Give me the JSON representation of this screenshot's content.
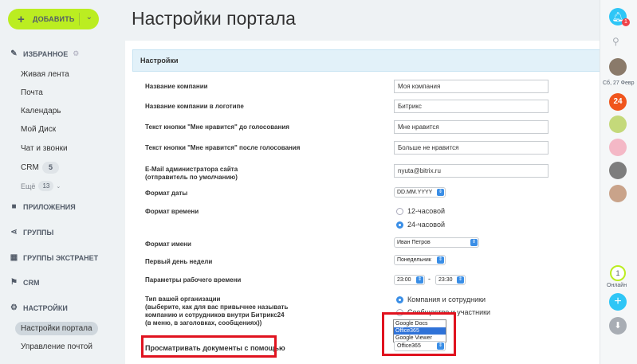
{
  "sidebar": {
    "add_label": "ДОБАВИТЬ",
    "favorites": "ИЗБРАННОЕ",
    "items": [
      "Живая лента",
      "Почта",
      "Календарь",
      "Мой Диск",
      "Чат и звонки",
      "CRM"
    ],
    "crm_count": "5",
    "more_label": "Ещё",
    "more_count": "13",
    "sections": [
      "ПРИЛОЖЕНИЯ",
      "ГРУППЫ",
      "ГРУППЫ ЭКСТРАНЕТ",
      "CRM",
      "НАСТРОЙКИ"
    ],
    "settings_items": [
      "Настройки портала",
      "Управление почтой"
    ]
  },
  "page": {
    "title": "Настройки портала",
    "card_header": "Настройки"
  },
  "form": {
    "company_name_label": "Название компании",
    "company_name_value": "Моя компания",
    "logo_name_label": "Название компании в логотипе",
    "logo_name_value": "Битрикс",
    "like_before_label": "Текст кнопки \"Мне нравится\" до голосования",
    "like_before_value": "Мне нравится",
    "like_after_label": "Текст кнопки \"Мне нравится\" после голосования",
    "like_after_value": "Больше не нравится",
    "email_label_1": "E-Mail администратора сайта",
    "email_label_2": "(отправитель по умолчанию)",
    "email_value": "nyuta@bitrix.ru",
    "date_format_label": "Формат даты",
    "date_format_value": "DD.MM.YYYY",
    "time_format_label": "Формат времени",
    "time_12": "12-часовой",
    "time_24": "24-часовой",
    "name_format_label": "Формат имени",
    "name_format_value": "Иван Петров",
    "first_day_label": "Первый день недели",
    "first_day_value": "Понедельник",
    "work_hours_label": "Параметры рабочего времени",
    "work_start": "23:00",
    "work_dash": "-",
    "work_end": "23:30",
    "org_type_label_1": "Тип вашей организации",
    "org_type_label_2": "(выберите, как для вас привычнее называть",
    "org_type_label_3": "компанию и сотрудников внутри Битрикс24",
    "org_type_label_4": "(в меню, в заголовках, сообщениях))",
    "org_company": "Компания и сотрудники",
    "org_community": "Сообщество и участники",
    "view_docs_label": "Просматривать документы с помощью",
    "view_docs_options": [
      "Google Docs",
      "Office365",
      "Google Viewer"
    ],
    "view_docs_value": "Office365"
  },
  "rightbar": {
    "badge": "1",
    "date": "Сб, 27 Февр",
    "b24": "24",
    "online_count": "1",
    "online_label": "Онлайн"
  },
  "colors": {
    "accent": "#bbed21",
    "brand_blue": "#2fc6f6",
    "highlight": "#e0131f"
  }
}
